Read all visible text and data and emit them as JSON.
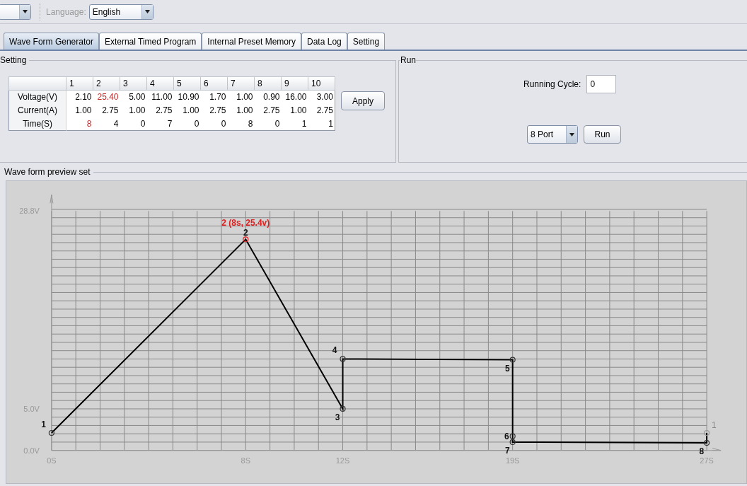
{
  "toolbar": {
    "language_label": "Language:",
    "language_value": "English"
  },
  "tabs": [
    {
      "label": "Wave Form Generator",
      "selected": true
    },
    {
      "label": "External Timed Program",
      "selected": false
    },
    {
      "label": "Internal Preset Memory",
      "selected": false
    },
    {
      "label": "Data Log",
      "selected": false
    },
    {
      "label": "Setting",
      "selected": false
    }
  ],
  "setting": {
    "title": "Setting",
    "columns": [
      "1",
      "2",
      "3",
      "4",
      "5",
      "6",
      "7",
      "8",
      "9",
      "10"
    ],
    "rows": [
      {
        "label": "Voltage(V)",
        "cells": [
          {
            "text": "2.10",
            "highlighted": false
          },
          {
            "text": "25.40",
            "highlighted": true
          },
          {
            "text": "5.00",
            "highlighted": false
          },
          {
            "text": "11.00",
            "highlighted": false
          },
          {
            "text": "10.90",
            "highlighted": false
          },
          {
            "text": "1.70",
            "highlighted": false
          },
          {
            "text": "1.00",
            "highlighted": false
          },
          {
            "text": "0.90",
            "highlighted": false
          },
          {
            "text": "16.00",
            "highlighted": false
          },
          {
            "text": "3.00",
            "highlighted": false
          }
        ]
      },
      {
        "label": "Current(A)",
        "cells": [
          {
            "text": "1.00",
            "highlighted": false
          },
          {
            "text": "2.75",
            "highlighted": false
          },
          {
            "text": "1.00",
            "highlighted": false
          },
          {
            "text": "2.75",
            "highlighted": false
          },
          {
            "text": "1.00",
            "highlighted": false
          },
          {
            "text": "2.75",
            "highlighted": false
          },
          {
            "text": "1.00",
            "highlighted": false
          },
          {
            "text": "2.75",
            "highlighted": false
          },
          {
            "text": "1.00",
            "highlighted": false
          },
          {
            "text": "2.75",
            "highlighted": false
          }
        ]
      },
      {
        "label": "Time(S)",
        "cells": [
          {
            "text": "8",
            "highlighted": true
          },
          {
            "text": "4",
            "highlighted": false
          },
          {
            "text": "0",
            "highlighted": false
          },
          {
            "text": "7",
            "highlighted": false
          },
          {
            "text": "0",
            "highlighted": false
          },
          {
            "text": "0",
            "highlighted": false
          },
          {
            "text": "8",
            "highlighted": false
          },
          {
            "text": "0",
            "highlighted": false
          },
          {
            "text": "1",
            "highlighted": false
          },
          {
            "text": "1",
            "highlighted": false
          }
        ]
      }
    ],
    "apply_button": "Apply"
  },
  "run": {
    "title": "Run",
    "cycle_label": "Running Cycle:",
    "cycle_value": "0",
    "port_value": "8 Port",
    "run_button": "Run"
  },
  "preview": {
    "title": "Wave form preview set",
    "chart_data": {
      "type": "line",
      "x": [
        0,
        8,
        12,
        12,
        19,
        19,
        19,
        27,
        27
      ],
      "series": [
        {
          "color": "#000000",
          "marker": true,
          "values": [
            2.1,
            25.4,
            5.0,
            11.0,
            10.9,
            1.7,
            1.0,
            0.9,
            2.1
          ]
        }
      ],
      "grid": true,
      "xlim": [
        0,
        27
      ],
      "ylim": [
        0,
        28.8
      ],
      "xticks": [
        {
          "value": 0,
          "label": "0S"
        },
        {
          "value": 8,
          "label": "8S"
        },
        {
          "value": 12,
          "label": "12S"
        },
        {
          "value": 19,
          "label": "19S"
        },
        {
          "value": 27,
          "label": "27S"
        }
      ],
      "yticks": [
        {
          "value": 0,
          "label": "0.0V"
        },
        {
          "value": 5,
          "label": "5.0V"
        },
        {
          "value": 28.8,
          "label": "28.8V"
        }
      ],
      "annotations": [
        {
          "x": 0,
          "y": 2.1,
          "text": "1"
        },
        {
          "x": 8,
          "y": 25.4,
          "text": "2 (8s, 25.4v)"
        },
        {
          "x": 8,
          "y": 25.4,
          "text": "2"
        },
        {
          "x": 12,
          "y": 5.0,
          "text": "3"
        },
        {
          "x": 12,
          "y": 11.0,
          "text": "4"
        },
        {
          "x": 19,
          "y": 10.9,
          "text": "5"
        },
        {
          "x": 19,
          "y": 1.7,
          "text": "6"
        },
        {
          "x": 19,
          "y": 1.0,
          "text": "7"
        },
        {
          "x": 27,
          "y": 0.9,
          "text": "8"
        },
        {
          "x": 27,
          "y": 2.1,
          "text": "1"
        }
      ]
    }
  }
}
